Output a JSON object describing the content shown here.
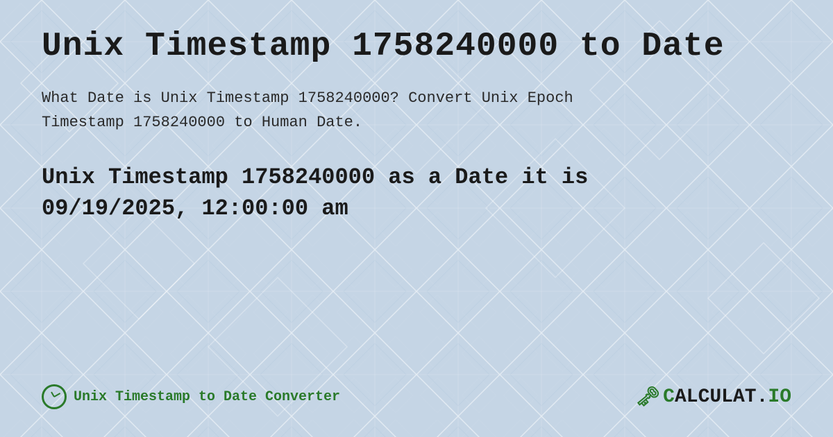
{
  "page": {
    "title": "Unix Timestamp 1758240000 to Date",
    "description_1": "What Date is Unix Timestamp 1758240000? Convert Unix Epoch",
    "description_2": "Timestamp 1758240000 to Human Date.",
    "result_line1": "Unix Timestamp 1758240000 as a Date it is",
    "result_line2": "09/19/2025, 12:00:00 am",
    "converter_label": "Unix Timestamp to Date Converter",
    "logo_text": "CALCULAT.IO",
    "background_color": "#c8d8e8",
    "accent_color": "#2a7a2a",
    "text_color": "#1a1a1a"
  }
}
